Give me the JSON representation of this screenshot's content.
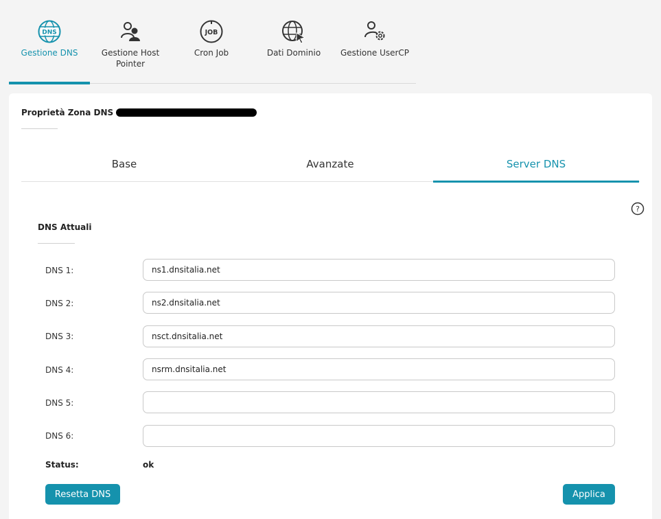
{
  "nav": {
    "items": [
      {
        "label": "Gestione DNS",
        "icon": "dns-globe-icon",
        "active": true
      },
      {
        "label": "Gestione Host Pointer",
        "icon": "user-group-icon",
        "active": false
      },
      {
        "label": "Cron Job",
        "icon": "job-icon",
        "active": false
      },
      {
        "label": "Dati Dominio",
        "icon": "globe-cursor-icon",
        "active": false
      },
      {
        "label": "Gestione UserCP",
        "icon": "user-gear-icon",
        "active": false
      }
    ]
  },
  "card": {
    "title": "Proprietà Zona DNS",
    "tabs": [
      {
        "label": "Base",
        "active": false
      },
      {
        "label": "Avanzate",
        "active": false
      },
      {
        "label": "Server DNS",
        "active": true
      }
    ],
    "section_title": "DNS Attuali",
    "dns": [
      {
        "label": "DNS 1:",
        "value": "ns1.dnsitalia.net"
      },
      {
        "label": "DNS 2:",
        "value": "ns2.dnsitalia.net"
      },
      {
        "label": "DNS 3:",
        "value": "nsct.dnsitalia.net"
      },
      {
        "label": "DNS 4:",
        "value": "nsrm.dnsitalia.net"
      },
      {
        "label": "DNS 5:",
        "value": ""
      },
      {
        "label": "DNS 6:",
        "value": ""
      }
    ],
    "status_label": "Status:",
    "status_value": "ok",
    "reset_button": "Resetta DNS",
    "apply_button": "Applica"
  },
  "colors": {
    "accent": "#1592ad",
    "background": "#f4f4f4"
  }
}
